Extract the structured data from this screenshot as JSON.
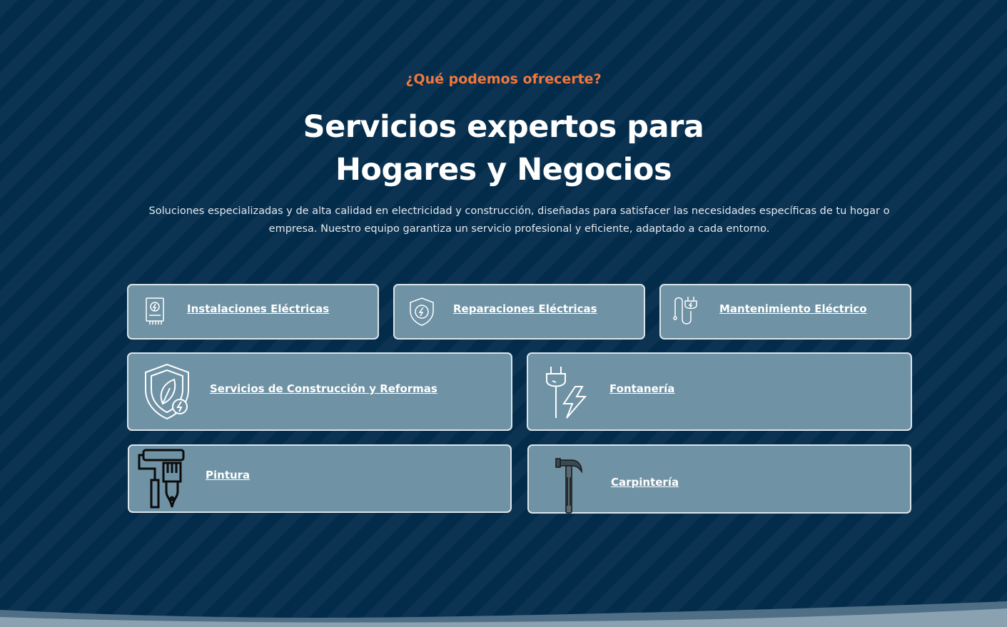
{
  "section": {
    "eyebrow": "¿Qué podemos ofrecerte?",
    "title_line1": "Servicios expertos para",
    "title_line2": "Hogares y Negocios",
    "description": "Soluciones especializadas y de alta calidad en electricidad y construcción, diseñadas para satisfacer las necesidades específicas de tu hogar o empresa. Nuestro equipo garantiza un servicio profesional y eficiente, adaptado a cada entorno."
  },
  "services": [
    {
      "label": "Instalaciones Eléctricas",
      "icon": "electrical-panel-icon"
    },
    {
      "label": "Reparaciones Eléctricas",
      "icon": "shield-bolt-icon"
    },
    {
      "label": "Mantenimiento Eléctrico",
      "icon": "plug-cable-icon"
    },
    {
      "label": "Servicios de Construcción y Reformas",
      "icon": "shield-leaf-bolt-icon"
    },
    {
      "label": "Fontanería",
      "icon": "plug-bolt-icon"
    },
    {
      "label": "Pintura",
      "icon": "paint-roller-brush-icon"
    },
    {
      "label": "Carpintería",
      "icon": "hammer-icon"
    }
  ],
  "colors": {
    "background": "#032c4b",
    "accent": "#f0783e",
    "card": "#6f92a5",
    "card_border": "#dbe4ea"
  }
}
